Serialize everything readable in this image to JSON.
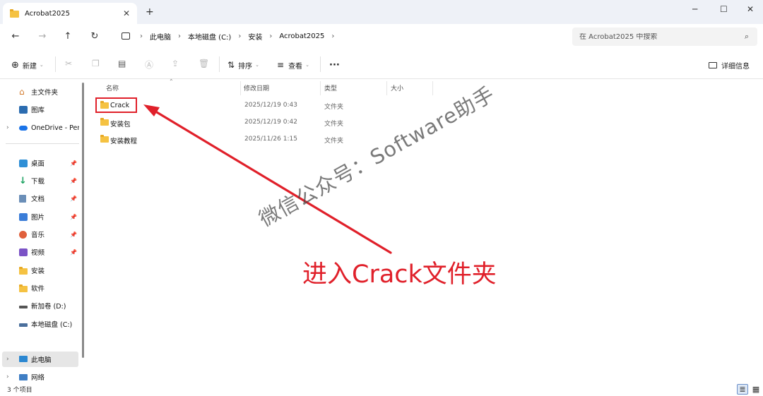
{
  "window": {
    "tab_title": "Acrobat2025",
    "tab_close": "✕",
    "new_tab": "+",
    "minimize": "─",
    "maximize": "☐",
    "close": "✕"
  },
  "nav": {
    "back": "←",
    "forward": "→",
    "up": "↑",
    "refresh": "↻",
    "breadcrumbs": [
      "此电脑",
      "本地磁盘 (C:)",
      "安装",
      "Acrobat2025"
    ],
    "breadcrumb_sep": "›",
    "search_placeholder": "在 Acrobat2025 中搜索",
    "search_icon": "search-icon"
  },
  "toolbar": {
    "new_label": "新建",
    "sort_label": "排序",
    "view_label": "查看",
    "more_label": "···",
    "details_label": "详细信息",
    "icons": [
      "cut-icon",
      "copy-icon",
      "paste-icon",
      "rename-icon",
      "share-icon",
      "delete-icon"
    ]
  },
  "sidebar": {
    "items": [
      {
        "label": "主文件夹",
        "icon": "home-icon"
      },
      {
        "label": "图库",
        "icon": "gallery-icon"
      },
      {
        "label": "OneDrive - Personal",
        "icon": "cloud-icon"
      },
      {
        "label": "桌面",
        "icon": "desktop-icon"
      },
      {
        "label": "下载",
        "icon": "download-icon"
      },
      {
        "label": "文档",
        "icon": "document-icon"
      },
      {
        "label": "图片",
        "icon": "pictures-icon"
      },
      {
        "label": "音乐",
        "icon": "music-icon"
      },
      {
        "label": "视频",
        "icon": "video-icon"
      },
      {
        "label": "安装",
        "icon": "folder-icon"
      },
      {
        "label": "软件",
        "icon": "folder-icon"
      },
      {
        "label": "新加卷 (D:)",
        "icon": "drive-icon"
      },
      {
        "label": "本地磁盘 (C:)",
        "icon": "drive-icon"
      },
      {
        "label": "此电脑",
        "icon": "pc-icon"
      },
      {
        "label": "网络",
        "icon": "network-icon"
      }
    ]
  },
  "filelist": {
    "columns": [
      "名称",
      "修改日期",
      "类型",
      "大小"
    ],
    "rows": [
      {
        "name": "Crack",
        "date": "2025/12/19 0:43",
        "type": "文件夹",
        "size": ""
      },
      {
        "name": "安装包",
        "date": "2025/12/19 0:42",
        "type": "文件夹",
        "size": ""
      },
      {
        "name": "安装教程",
        "date": "2025/11/26 1:15",
        "type": "文件夹",
        "size": ""
      }
    ]
  },
  "status": {
    "item_count": "3 个项目"
  },
  "annotations": {
    "watermark": "微信公众号：Software助手",
    "instruction": "进入Crack文件夹",
    "accent_color": "#e0202a"
  }
}
